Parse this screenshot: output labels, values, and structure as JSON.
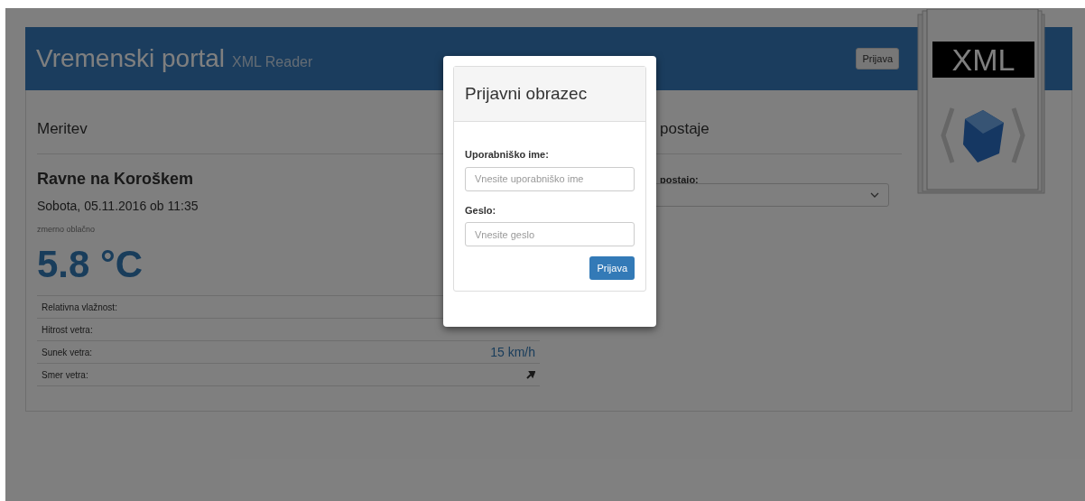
{
  "header": {
    "title": "Vremenski portal",
    "subtitle": "XML Reader",
    "login_button": "Prijava",
    "logo_text": "XML"
  },
  "measurement": {
    "heading": "Meritev",
    "location": "Ravne na Koroškem",
    "datetime": "Sobota, 05.11.2016 ob 11:35",
    "condition": "zmerno oblačno",
    "temperature": "5.8 °C",
    "rows": [
      {
        "label": "Relativna vlažnost:",
        "kind": "text"
      },
      {
        "label": "Hitrost vetra:",
        "kind": "text"
      },
      {
        "label": "Sunek vetra:",
        "value": "15 km/h",
        "kind": "text"
      },
      {
        "label": "Smer vetra:",
        "kind": "icon"
      }
    ]
  },
  "station": {
    "heading": "postaje",
    "select_label": "postajo:"
  },
  "modal": {
    "title": "Prijavni obrazec",
    "username_label": "Uporabniško ime:",
    "username_placeholder": "Vnesite uporabniško ime",
    "password_label": "Geslo:",
    "password_placeholder": "Vnesite geslo",
    "submit": "Prijava"
  }
}
